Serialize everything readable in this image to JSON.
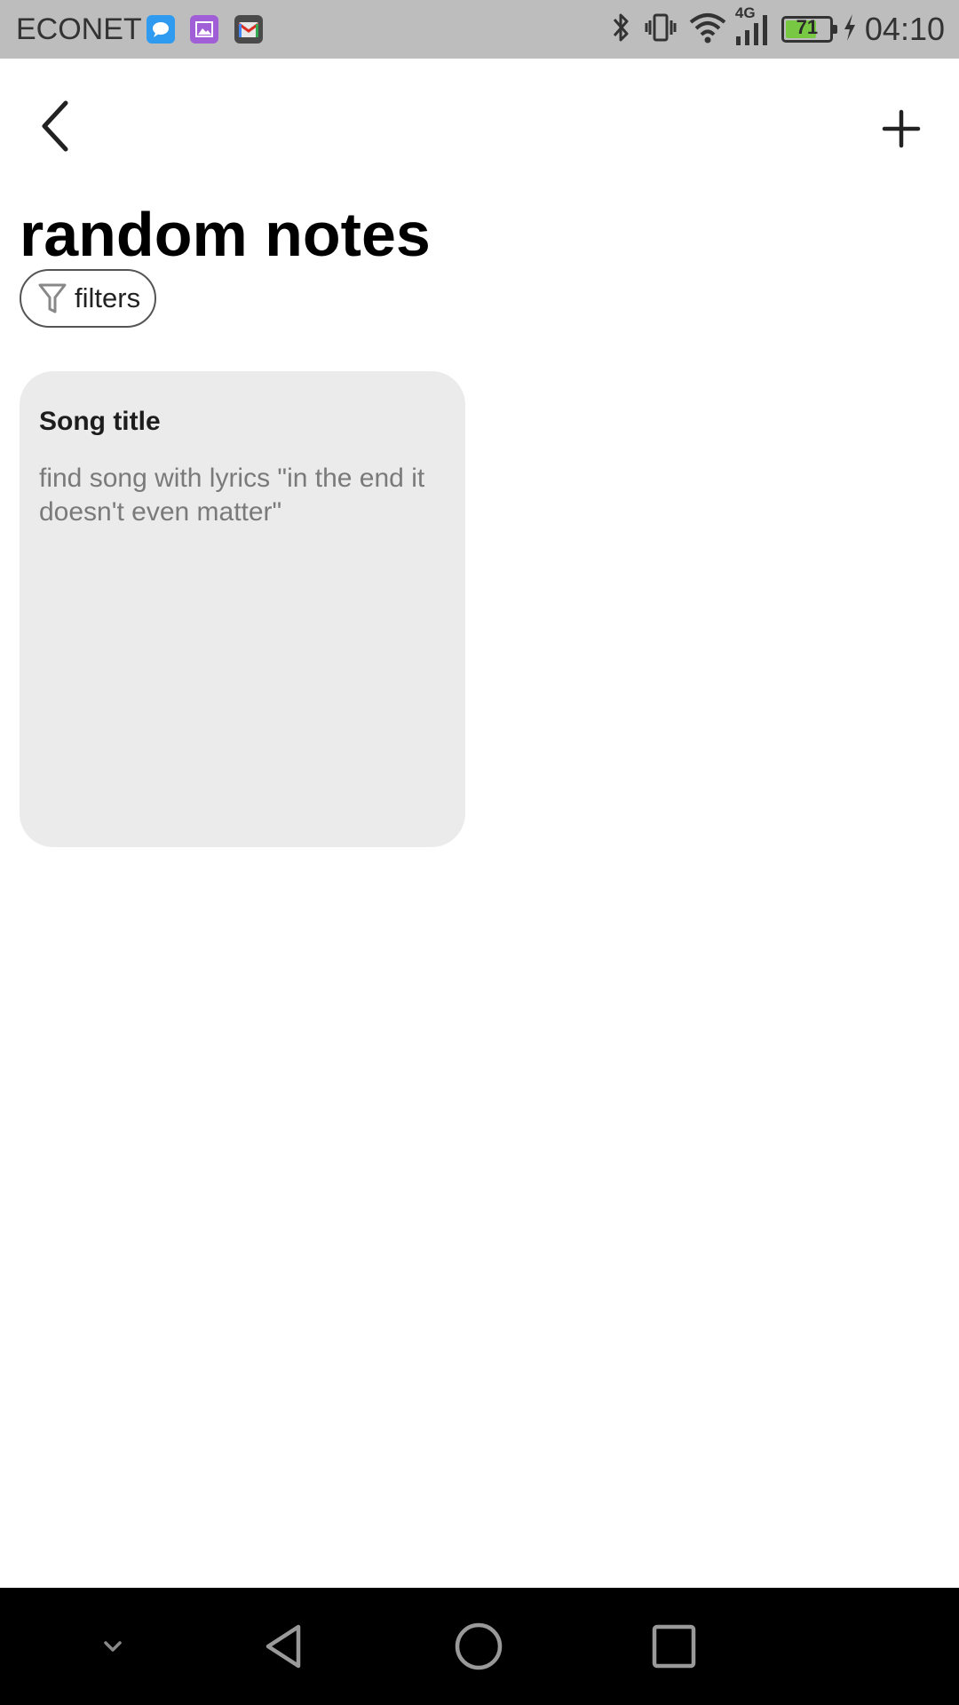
{
  "status_bar": {
    "carrier": "ECONET",
    "network_type": "4G",
    "battery_percent": "71",
    "battery_level": 0.71,
    "time": "04:10",
    "notification_icons": [
      "messages-icon",
      "gallery-icon",
      "gmail-icon"
    ],
    "system_icons": [
      "bluetooth-icon",
      "vibrate-icon",
      "wifi-icon",
      "cellular-signal-icon",
      "battery-icon",
      "charging-icon"
    ]
  },
  "header": {
    "back_icon": "chevron-left-icon",
    "add_icon": "plus-icon",
    "title": "random notes"
  },
  "filters": {
    "icon": "funnel-icon",
    "label": "filters"
  },
  "notes": [
    {
      "title": "Song title",
      "body": "find song with lyrics \"in the end it doesn't even matter\""
    }
  ],
  "nav_bar": {
    "items": [
      "hide-nav-icon",
      "back-triangle-icon",
      "home-circle-icon",
      "recents-square-icon"
    ]
  },
  "colors": {
    "status_bar_bg": "#bdbdbd",
    "card_bg": "#ebebeb",
    "battery_fill": "#78c843",
    "nav_bar_bg": "#000000"
  }
}
